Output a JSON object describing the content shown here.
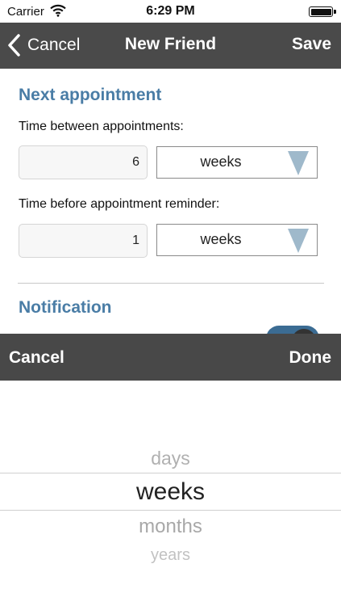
{
  "status_bar": {
    "carrier": "Carrier",
    "time": "6:29 PM"
  },
  "nav": {
    "back_label": "Cancel",
    "title": "New Friend",
    "save_label": "Save"
  },
  "next_appointment": {
    "section_title": "Next appointment",
    "between": {
      "label": "Time between appointments:",
      "value": "6",
      "unit": "weeks"
    },
    "reminder": {
      "label": "Time before appointment reminder:",
      "value": "1",
      "unit": "weeks"
    }
  },
  "notification": {
    "section_title": "Notification",
    "toggle_on": true
  },
  "picker": {
    "cancel_label": "Cancel",
    "done_label": "Done",
    "options": [
      "days",
      "weeks",
      "months",
      "years"
    ],
    "selected": "weeks"
  },
  "colors": {
    "nav": "#4a4a4a",
    "toolbar": "#484848",
    "accent": "#4a7da6",
    "arrow": "#9fb9cb"
  }
}
